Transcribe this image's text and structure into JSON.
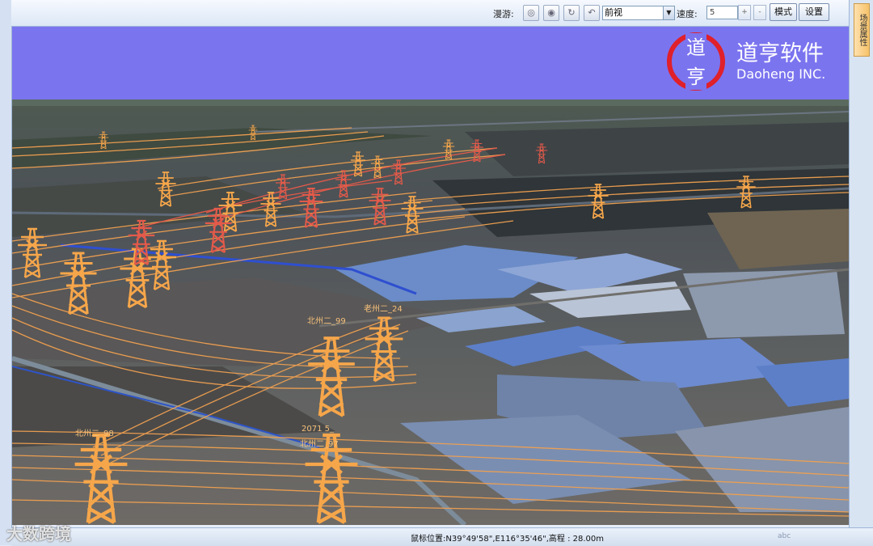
{
  "toolbar": {
    "roam_label": "漫游:",
    "view_select_value": "前视",
    "speed_label": "速度:",
    "speed_value": "5",
    "spin_up": "+",
    "spin_down": "-",
    "mode_button": "模式",
    "settings_button": "设置"
  },
  "side_panel": {
    "tab_label": "场景属性"
  },
  "logo": {
    "mark_top": "道",
    "mark_bottom": "亨",
    "name_cn": "道亨软件",
    "name_en": "Daoheng INC."
  },
  "tower_labels": [
    "老州二_24",
    "北州二_99",
    "北州二_98",
    "2071 5_",
    "北州二_97"
  ],
  "status": {
    "mouse_position": "鼠标位置:N39°49'58\",E116°35'46\",高程 : 28.00m",
    "ime": "abc"
  },
  "watermark": "大数跨境",
  "colors": {
    "sky": "#7b74ef",
    "tower_orange": "#f6a64a",
    "tower_red": "#e35a4a",
    "wire": "#f0a050"
  }
}
